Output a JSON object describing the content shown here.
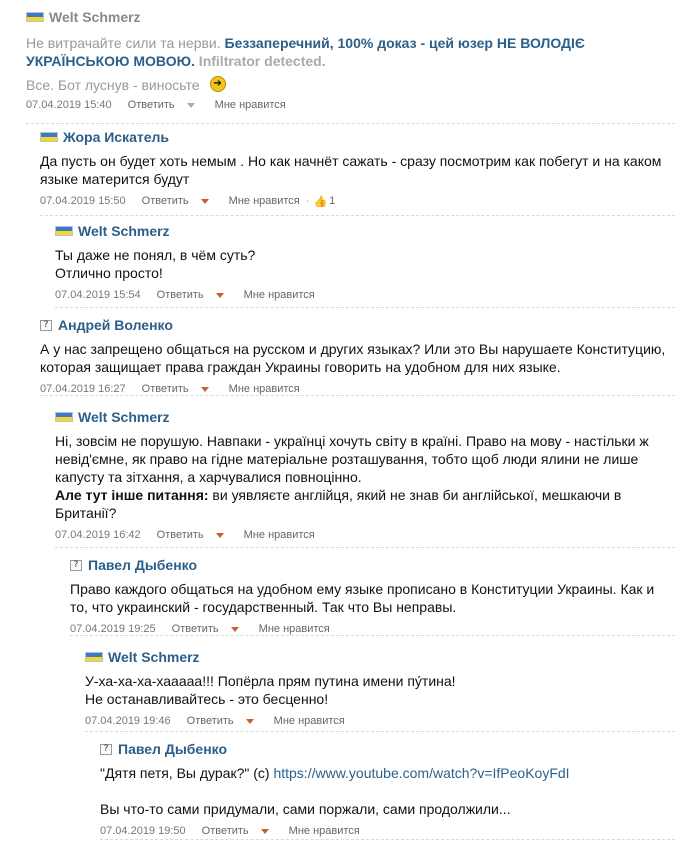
{
  "comments": [
    {
      "author": "Welt Schmerz",
      "body_intro": "Не витрачайте сили та нерви. ",
      "body_bold": "Беззаперечний, 100% доказ - цей юзер НЕ ВОЛОДІЄ УКРАЇНСЬКОЮ МОВОЮ.",
      "body_grey_bold": " Infiltrator detected.",
      "body_line2": "Все. Бот луснув - виносьте",
      "date": "07.04.2019 15:40",
      "reply": "Ответить",
      "like": "Мне нравится"
    },
    {
      "author": "Жора Искатель",
      "body": "Да пусть он будет хоть немым . Но как начнёт сажать - сразу посмотрим как побегут и на каком языке матерится будут",
      "date": "07.04.2019 15:50",
      "reply": "Ответить",
      "like": "Мне нравится",
      "likes": "1"
    },
    {
      "author": "Welt Schmerz",
      "line1": "Ты даже не понял, в чём суть?",
      "line2": "Отлично просто!",
      "date": "07.04.2019 15:54",
      "reply": "Ответить",
      "like": "Мне нравится"
    },
    {
      "author": "Андрей Воленко",
      "body": "А у нас запрещено общаться на русском и других языках? Или это Вы нарушаете Конституцию, которая защищает права граждан Украины говорить на удобном для них языке.",
      "date": "07.04.2019 16:27",
      "reply": "Ответить",
      "like": "Мне нравится"
    },
    {
      "author": "Welt Schmerz",
      "body": "Ні, зовсім не порушую. Навпаки - українці хочуть світу в країні. Право на мову - настільки ж невід'ємне, як право на гідне матеріальне розташування, тобто щоб люди ялини не лише капусту та зітхання, а харчувалися повноцінно.",
      "bold_prefix": "Але тут інше питання:",
      "body2": " ви уявляєте англійця, який не знав би англійської, мешкаючи в Британії?",
      "date": "07.04.2019 16:42",
      "reply": "Ответить",
      "like": "Мне нравится"
    },
    {
      "author": "Павел Дыбенко",
      "body": "Право каждого общаться на удобном ему языке прописано в Конституции Украины. Как и то, что украинский - государственный. Так что Вы неправы.",
      "date": "07.04.2019 19:25",
      "reply": "Ответить",
      "like": "Мне нравится"
    },
    {
      "author": "Welt Schmerz",
      "line1": "У-ха-ха-ха-хааааа!!! Попёрла прям путина имени пу́тина!",
      "line2": "Не останавливайтесь - это бесценно!",
      "date": "07.04.2019 19:46",
      "reply": "Ответить",
      "like": "Мне нравится"
    },
    {
      "author": "Павел Дыбенко",
      "line1_text": "\"Дятя петя, Вы дурак?\" (с) ",
      "line1_link": "https://www.youtube.com/watch?v=IfPeoKoyFdI",
      "line2": "Вы что-то сами придумали, сами поржали, сами продолжили...",
      "date": "07.04.2019 19:50",
      "reply": "Ответить",
      "like": "Мне нравится"
    }
  ],
  "colors": {
    "author": "#2b5f8a",
    "caret": "#c8612b",
    "flag_blue": "#3a78c9",
    "flag_yellow": "#f4d72a"
  }
}
